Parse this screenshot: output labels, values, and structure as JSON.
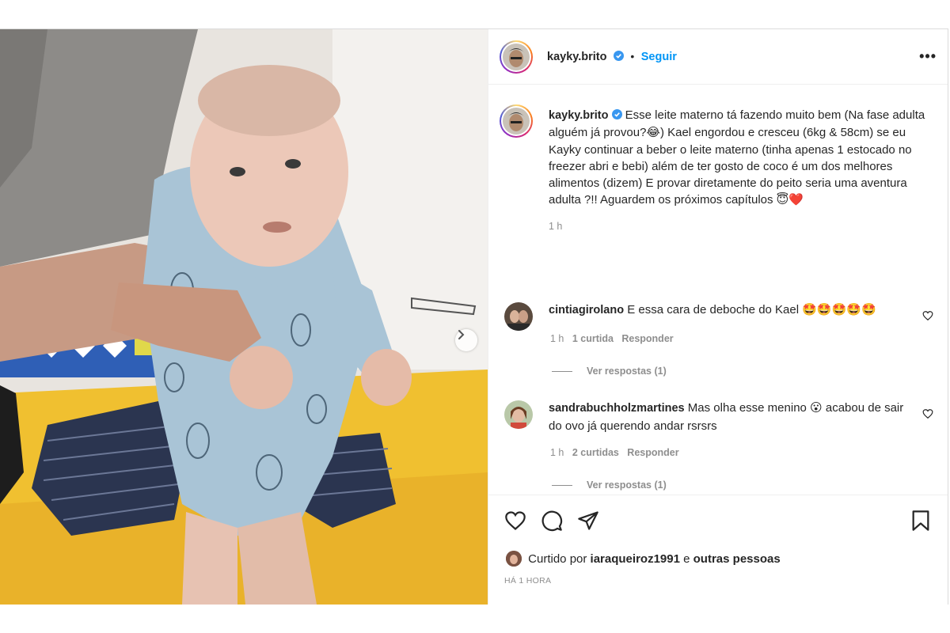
{
  "post": {
    "author": "kayky.brito",
    "follow_label": "Seguir",
    "dot": "•",
    "more_label": "•••",
    "caption": "Esse leite materno tá fazendo muito bem (Na fase adulta alguém já provou?😂) Kael engordou e cresceu (6kg & 58cm) se eu Kayky continuar a beber o leite materno (tinha apenas 1 estocado no freezer abri e bebi) além de ter gosto de coco é um dos melhores alimentos (dizem) E provar diretamente do peito seria uma aventura adulta ?!! Aguardem os próximos capítulos 😇❤️",
    "caption_time": "1 h"
  },
  "comments": [
    {
      "user": "cintiagirolano",
      "text": "E essa cara de deboche do Kael 🤩🤩🤩🤩🤩",
      "time": "1 h",
      "likes": "1 curtida",
      "reply_label": "Responder",
      "view_replies": "Ver respostas (1)"
    },
    {
      "user": "sandrabuchholzmartines",
      "text": "Mas olha esse menino 😮 acabou de sair do ovo já querendo andar rsrsrs",
      "time": "1 h",
      "likes": "2 curtidas",
      "reply_label": "Responder",
      "view_replies": "Ver respostas (1)"
    }
  ],
  "footer": {
    "liked_by_prefix": "Curtido por",
    "liked_by_user": "iaraqueiroz1991",
    "liked_by_and": "e",
    "liked_by_others": "outras pessoas",
    "timestamp": "HÁ 1 HORA"
  },
  "colors": {
    "link_blue": "#0095f6",
    "verified_blue": "#3897f0",
    "heart_red": "#ed4956"
  },
  "icons": [
    "heart-icon",
    "comment-icon",
    "share-icon",
    "bookmark-icon",
    "chevron-right-icon",
    "verified-badge-icon",
    "more-icon"
  ]
}
